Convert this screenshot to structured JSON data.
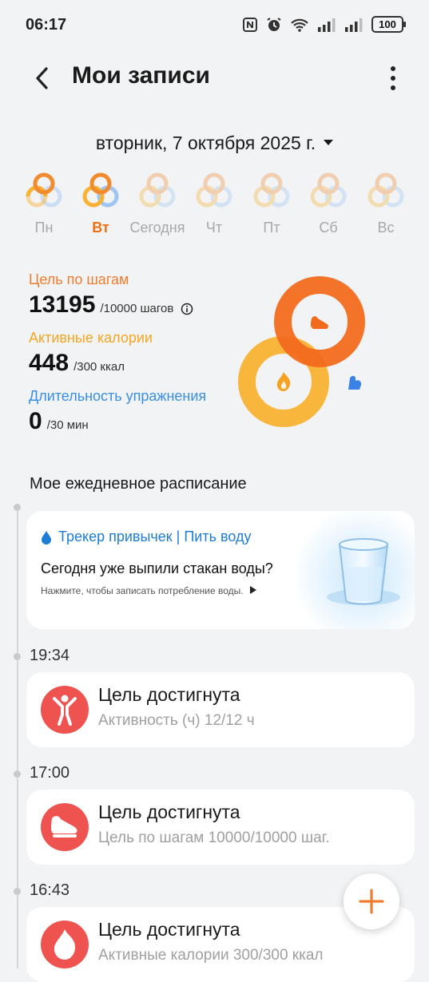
{
  "status": {
    "time": "06:17",
    "battery": "100"
  },
  "header": {
    "title": "Мои записи"
  },
  "date_selector": {
    "label": "вторник, 7 октября 2025 г."
  },
  "week": [
    {
      "label": "Пн",
      "state": "partial"
    },
    {
      "label": "Вт",
      "state": "active"
    },
    {
      "label": "Сегодня",
      "state": "faded"
    },
    {
      "label": "Чт",
      "state": "faded"
    },
    {
      "label": "Пт",
      "state": "faded"
    },
    {
      "label": "Сб",
      "state": "faded"
    },
    {
      "label": "Вс",
      "state": "faded"
    }
  ],
  "stats": {
    "steps": {
      "label": "Цель по шагам",
      "value": "13195",
      "goal": "/10000 шагов",
      "color": "#f07c2e"
    },
    "calories": {
      "label": "Активные калории",
      "value": "448",
      "goal": "/300 ккал",
      "color": "#f5a623"
    },
    "exercise": {
      "label": "Длительность упражнения",
      "value": "0",
      "goal": "/30 мин",
      "color": "#3b8fe3"
    }
  },
  "rings": {
    "steps": {
      "color": "#f26b1d",
      "progress": 1.0
    },
    "calories": {
      "color": "#f9b233",
      "progress": 1.0
    },
    "exercise": {
      "color": "#b9d4f5",
      "progress": 0.0
    }
  },
  "schedule": {
    "title": "Мое ежедневное расписание",
    "habit_card": {
      "tag": "Трекер привычек | Пить воду",
      "question": "Сегодня уже выпили стакан воды?",
      "hint": "Нажмите, чтобы записать потребление воды."
    },
    "entries": [
      {
        "time": "19:34",
        "title": "Цель достигнута",
        "subtitle": "Активность (ч) 12/12 ч",
        "icon": "person-icon"
      },
      {
        "time": "17:00",
        "title": "Цель достигнута",
        "subtitle": "Цель по шагам 10000/10000 шаг.",
        "icon": "shoe-icon"
      },
      {
        "time": "16:43",
        "title": "Цель достигнута",
        "subtitle": "Активные калории 300/300 ккал",
        "icon": "flame-icon"
      }
    ]
  },
  "fab": {
    "icon": "plus-icon"
  }
}
